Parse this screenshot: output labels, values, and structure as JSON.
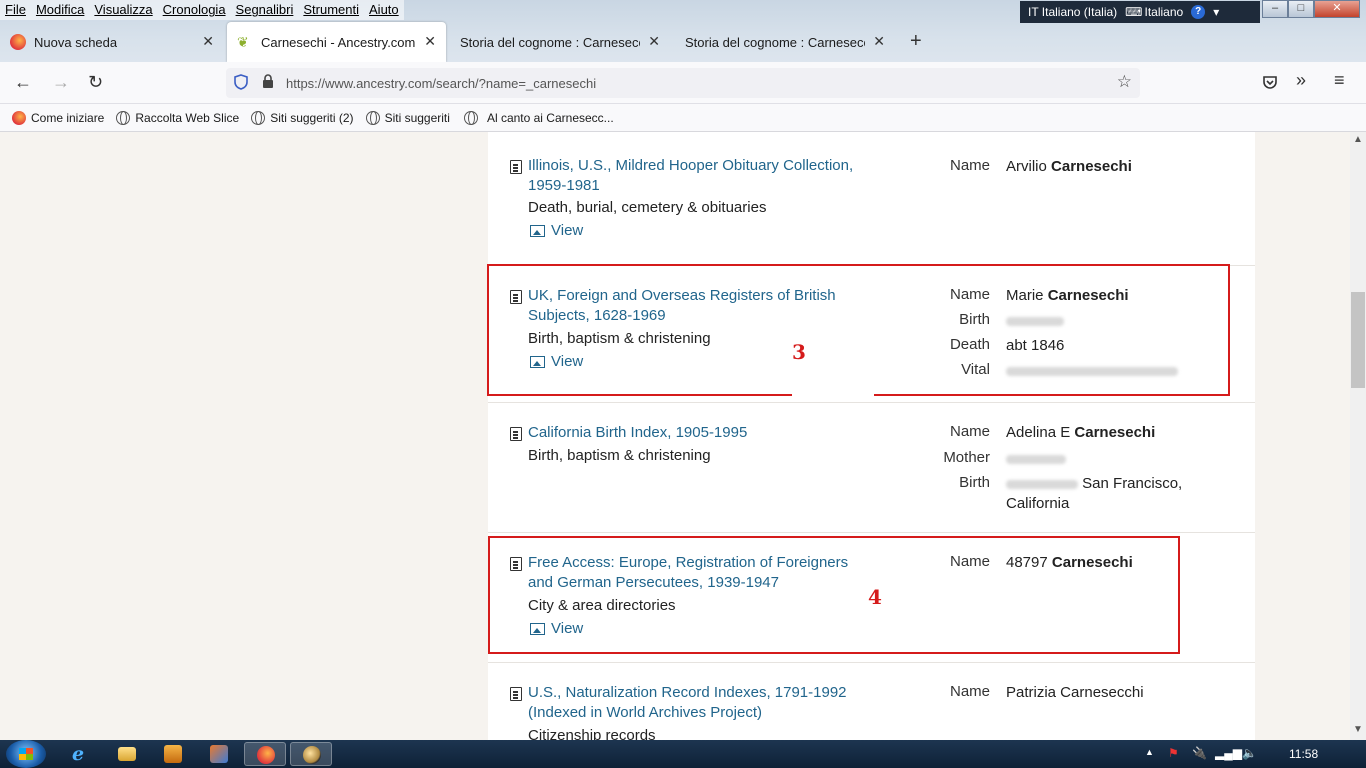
{
  "menubar": {
    "items": [
      "File",
      "Modifica",
      "Visualizza",
      "Cronologia",
      "Segnalibri",
      "Strumenti",
      "Aiuto"
    ]
  },
  "language_bar": {
    "input_language": "IT Italiano (Italia)",
    "keyboard": "Italiano",
    "help": "?"
  },
  "tabs": [
    {
      "label": "Nuova scheda"
    },
    {
      "label": "Carnesechi - Ancestry.com"
    },
    {
      "label": "Storia del cognome : Carnesecchi pa"
    },
    {
      "label": "Storia del cognome : Carnesecchi pa"
    }
  ],
  "navbar": {
    "url": "https://www.ancestry.com/search/?name=_carnesechi"
  },
  "bookmarks": [
    {
      "label": "Come iniziare",
      "icon": "firefox-icon"
    },
    {
      "label": "Raccolta Web Slice",
      "icon": "globe-icon"
    },
    {
      "label": "Siti suggeriti (2)",
      "icon": "globe-icon"
    },
    {
      "label": "Siti suggeriti",
      "icon": "globe-icon"
    },
    {
      "label": "Al canto ai Carnesecc...",
      "icon": "globe-icon"
    }
  ],
  "records": [
    {
      "title": "Illinois, U.S., Mildred Hooper Obituary Collection, 1959-1981",
      "category": "Death, burial, cemetery & obituaries",
      "view": "View",
      "name_first": "Arvilio",
      "name_last": "Carnesechi"
    },
    {
      "title": "UK, Foreign and Overseas Registers of British Subjects, 1628-1969",
      "category": "Birth, baptism & christening",
      "view": "View",
      "name_first": "Marie",
      "name_last": "Carnesechi",
      "death": "abt 1846"
    },
    {
      "title": "California Birth Index, 1905-1995",
      "category": "Birth, baptism & christening",
      "name_first": "Adelina E",
      "name_last": "Carnesechi",
      "birth_place": "San Francisco, California"
    },
    {
      "title": "Free Access: Europe, Registration of Foreigners and German Persecutees, 1939-1947",
      "category": "City & area directories",
      "view": "View",
      "name_first": "48797",
      "name_last": "Carnesechi"
    },
    {
      "title": "U.S., Naturalization Record Indexes, 1791-1992 (Indexed in World Archives Project)",
      "category": "Citizenship records",
      "name_full": "Patrizia Carnesecchi"
    }
  ],
  "field_labels": {
    "name": "Name",
    "birth": "Birth",
    "death": "Death",
    "vital": "Vital",
    "mother": "Mother"
  },
  "annotations": [
    "3",
    "4"
  ],
  "taskbar": {
    "clock": "11:58"
  },
  "colors": {
    "link": "#21658c",
    "annotation": "#d51b1b"
  }
}
